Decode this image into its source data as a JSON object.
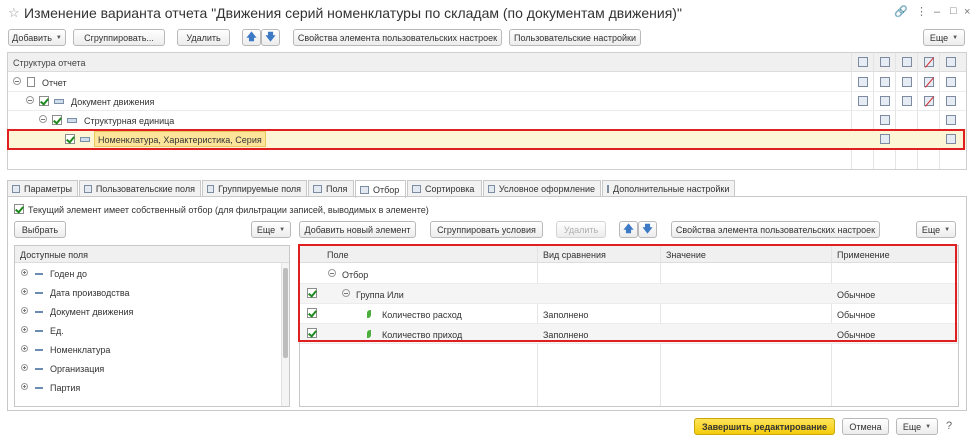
{
  "window": {
    "title": "Изменение варианта отчета \"Движения серий номенклатуры по складам (по документам движения)\"",
    "controls": [
      "link-icon",
      "more-icon",
      "minimize-icon",
      "maximize-icon",
      "close-icon"
    ]
  },
  "toolbar": {
    "add_label": "Добавить",
    "group_label": "Сгруппировать...",
    "delete_label": "Удалить",
    "element_props_label": "Свойства элемента пользовательских настроек",
    "user_settings_label": "Пользовательские настройки",
    "more_label": "Еще"
  },
  "structure": {
    "header": "Структура отчета",
    "rows": [
      {
        "label": "Отчет"
      },
      {
        "label": "Документ движения"
      },
      {
        "label": "Структурная единица"
      },
      {
        "label": "Номенклатура, Характеристика, Серия"
      }
    ]
  },
  "tabs": [
    {
      "label": "Параметры"
    },
    {
      "label": "Пользовательские поля"
    },
    {
      "label": "Группируемые поля"
    },
    {
      "label": "Поля"
    },
    {
      "label": "Отбор"
    },
    {
      "label": "Сортировка"
    },
    {
      "label": "Условное оформление"
    },
    {
      "label": "Дополнительные настройки"
    }
  ],
  "filter": {
    "own_filter_label": "Текущий элемент имеет собственный отбор (для фильтрации записей, выводимых в элементе)",
    "select_label": "Выбрать",
    "more_label": "Еще",
    "add_new_label": "Добавить новый элемент",
    "group_conditions_label": "Сгруппировать условия",
    "delete_label": "Удалить",
    "element_props_label": "Свойства элемента пользовательских настроек",
    "more2_label": "Еще"
  },
  "available_fields": {
    "header": "Доступные поля",
    "items": [
      "Годен до",
      "Дата производства",
      "Документ движения",
      "Ед.",
      "Номенклатура",
      "Организация",
      "Партия"
    ]
  },
  "filter_table": {
    "columns": [
      "Поле",
      "Вид сравнения",
      "Значение",
      "Применение"
    ],
    "rows": [
      {
        "field": "Отбор",
        "comparison": "",
        "value": "",
        "usage": ""
      },
      {
        "field": "Группа Или",
        "comparison": "",
        "value": "",
        "usage": "Обычное"
      },
      {
        "field": "Количество расход",
        "comparison": "Заполнено",
        "value": "",
        "usage": "Обычное"
      },
      {
        "field": "Количество приход",
        "comparison": "Заполнено",
        "value": "",
        "usage": "Обычное"
      }
    ]
  },
  "footer": {
    "finish_label": "Завершить редактирование",
    "cancel_label": "Отмена",
    "more_label": "Еще"
  },
  "colors": {
    "highlight_frame": "#e02020",
    "primary_button": "#f5d01a",
    "selected_row": "#fce59a"
  }
}
